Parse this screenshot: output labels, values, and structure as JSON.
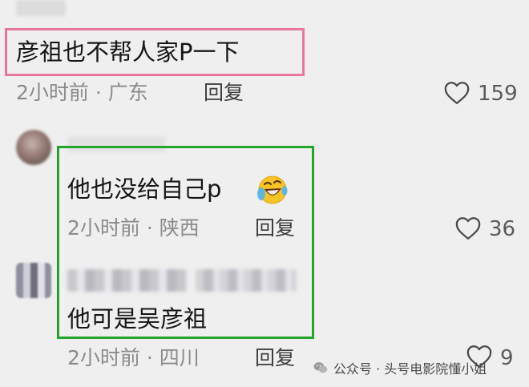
{
  "comments": [
    {
      "text": "彦祖也不帮人家P一下",
      "meta": "2小时前 · 广东",
      "reply": "回复",
      "likes": "159"
    },
    {
      "text": "他也没给自己p",
      "meta": "2小时前 · 陕西",
      "reply": "回复",
      "likes": "36"
    },
    {
      "text": "他可是吴彦祖",
      "meta": "2小时前 · 四川",
      "reply": "回复",
      "likes": "9"
    }
  ],
  "watermark": {
    "text": "公众号 · 头号电影院懂小姐"
  },
  "colors": {
    "highlight_pink": "#e9779c",
    "highlight_green": "#27a52a",
    "background": "#efefef"
  },
  "icons": [
    "heart-icon",
    "laughing-crying-emoji-icon",
    "wechat-icon"
  ]
}
